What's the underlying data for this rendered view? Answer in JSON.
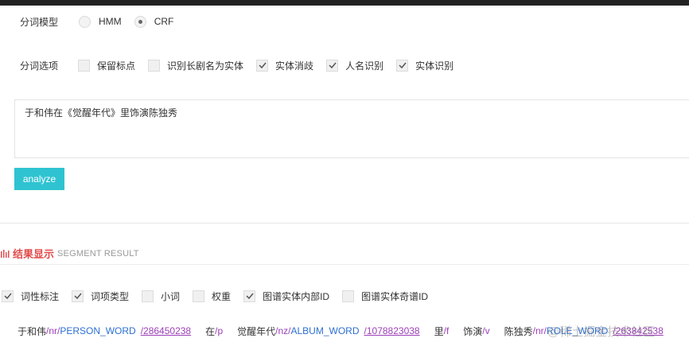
{
  "model": {
    "label": "分词模型",
    "options": [
      {
        "label": "HMM",
        "checked": false
      },
      {
        "label": "CRF",
        "checked": true
      }
    ]
  },
  "options_row": {
    "label": "分词选项",
    "options": [
      {
        "label": "保留标点",
        "checked": false
      },
      {
        "label": "识别长剧名为实体",
        "checked": false
      },
      {
        "label": "实体消歧",
        "checked": true
      },
      {
        "label": "人名识别",
        "checked": true
      },
      {
        "label": "实体识别",
        "checked": true
      }
    ]
  },
  "input": {
    "value": "于和伟在《觉醒年代》里饰演陈独秀"
  },
  "analyze": {
    "label": "analyze"
  },
  "result": {
    "title": "结果显示",
    "subtitle": "SEGMENT RESULT"
  },
  "display_options": [
    {
      "label": "词性标注",
      "checked": true
    },
    {
      "label": "词项类型",
      "checked": true
    },
    {
      "label": "小词",
      "checked": false
    },
    {
      "label": "权重",
      "checked": false
    },
    {
      "label": "图谱实体内部ID",
      "checked": true
    },
    {
      "label": "图谱实体奇谱ID",
      "checked": false
    }
  ],
  "segments": [
    {
      "word": "于和伟",
      "pos": "/nr/",
      "type": "PERSON_WORD",
      "id": "/286450238"
    },
    {
      "word": "在",
      "pos": "/p"
    },
    {
      "word": "觉醒年代",
      "pos": "/nz/",
      "type": "ALBUM_WORD",
      "id": "/1078823038"
    },
    {
      "word": "里",
      "pos": "/f"
    },
    {
      "word": "饰演",
      "pos": "/v"
    },
    {
      "word": "陈独秀",
      "pos": "/nr/",
      "type": "ROLE_WORD",
      "id": "/263842538"
    }
  ],
  "watermark": "@稀土掘金技术社区",
  "colors": {
    "accent": "#2fc3d1",
    "result_title": "#e14b4b",
    "pos": "#9c3fb8",
    "type": "#2d6fd2"
  }
}
